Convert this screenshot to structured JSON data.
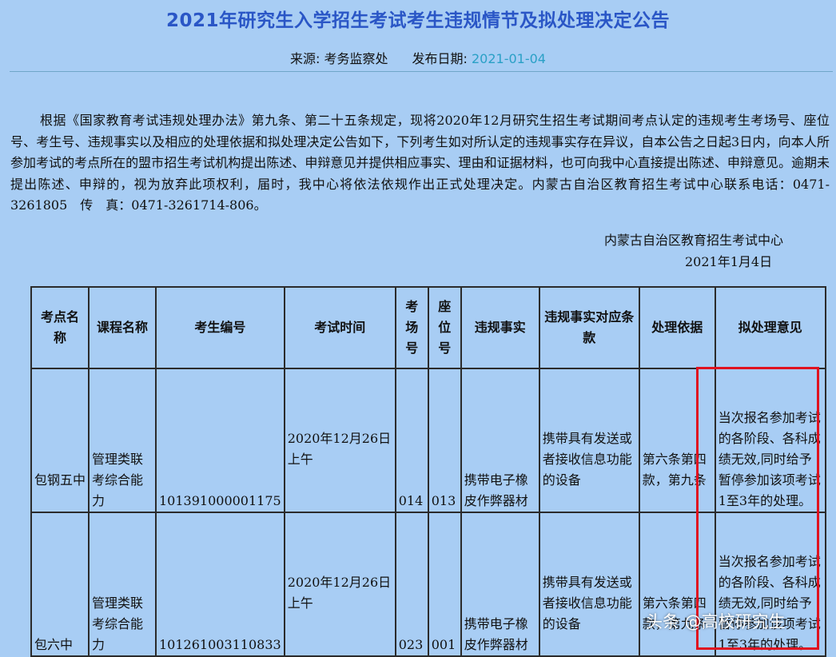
{
  "header": {
    "title": "2021年研究生入学招生考试考生违规情节及拟处理决定公告",
    "source_label": "来源: 考务监察处",
    "date_label": "发布日期: ",
    "date_value": "2021-01-04"
  },
  "notice": {
    "paragraph": "根据《国家教育考试违规处理办法》第九条、第二十五条规定，现将2020年12月研究生招生考试期间考点认定的违规考生考场号、座位号、考生号、违规事实以及相应的处理依据和拟处理决定公告如下，下列考生如对所认定的违规事实存在异议，自本公告之日起3日内，向本人所参加考试的考点所在的盟市招生考试机构提出陈述、申辩意见并提供相应事实、理由和证据材料，也可向我中心直接提出陈述、申辩意见。逾期未提出陈述、申辩的，视为放弃此项权利，届时，我中心将依法依规作出正式处理决定。内蒙古自治区教育招生考试中心联系电话：0471-3261805　传　真：0471-3261714-806。",
    "signature_org": "内蒙古自治区教育招生考试中心",
    "signature_date": "2021年1月4日"
  },
  "table": {
    "headers": [
      "考点名称",
      "课程名称",
      "考生编号",
      "考试时间",
      "考场号",
      "座位号",
      "违规事实",
      "违规事实对应条款",
      "处理依据",
      "拟处理意见"
    ],
    "rows": [
      {
        "site": "包钢五中",
        "course": "管理类联考综合能力",
        "candidate_id": "101391000001175",
        "exam_time": "2020年12月26日上午",
        "room": "014",
        "seat": "013",
        "violation": "携带电子橡皮作弊器材",
        "clause": "携带具有发送或者接收信息功能的设备",
        "basis": "第六条第四款，第九条",
        "decision": "当次报名参加考试的各阶段、各科成绩无效,同时给予暂停参加该项考试1至3年的处理。"
      },
      {
        "site": "包六中",
        "course": "管理类联考综合能力",
        "candidate_id": "101261003110833",
        "exam_time": "2020年12月26日上午",
        "room": "023",
        "seat": "001",
        "violation": "携带电子橡皮作弊器材",
        "clause": "携带具有发送或者接收信息功能的设备",
        "basis": "第六条第四款，第九条",
        "decision": "当次报名参加考试的各阶段、各科成绩无效,同时给予暂停参加该项考试1至3年的处理。"
      }
    ]
  },
  "watermark": "头条 @高校研究生",
  "colors": {
    "background": "#a8cdf4",
    "title": "#2a56c6",
    "date": "#2aa0c6",
    "highlight_box": "#e0121f"
  }
}
